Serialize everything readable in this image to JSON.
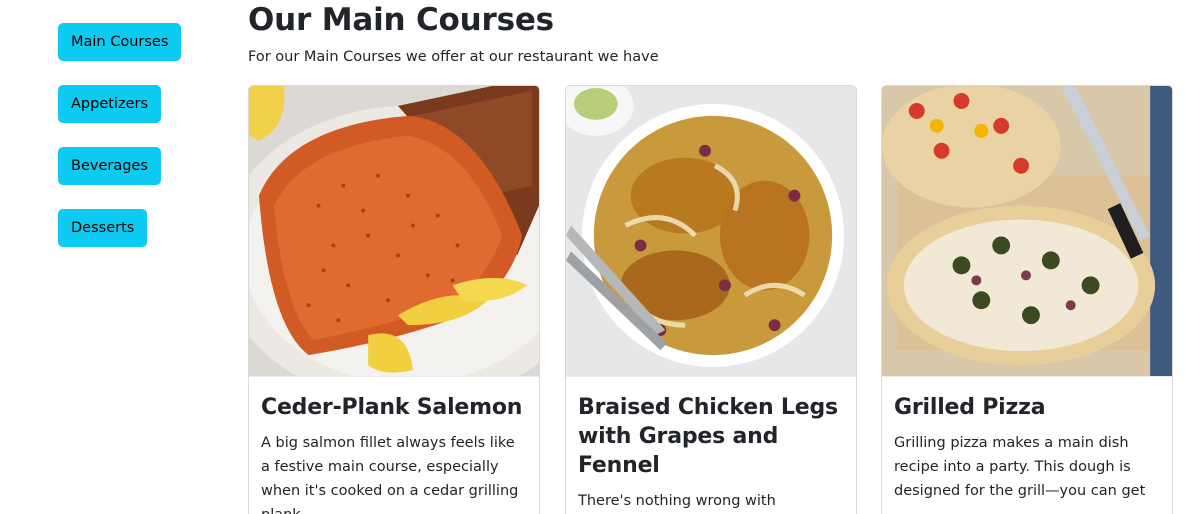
{
  "sidebar": {
    "items": [
      {
        "label": "Main Courses"
      },
      {
        "label": "Appetizers"
      },
      {
        "label": "Beverages"
      },
      {
        "label": "Desserts"
      }
    ]
  },
  "main": {
    "title": "Our Main Courses",
    "subtitle": "For our Main Courses we offer at our restaurant we have",
    "cards": [
      {
        "title": "Ceder-Plank Salemon",
        "text": "A big salmon fillet always feels like a festive main course, especially when it's cooked on a cedar grilling plank,",
        "image": "salmon-photo"
      },
      {
        "title": "Braised Chicken Legs with Grapes and Fennel",
        "text": "There's nothing wrong with defaulting to chicken when you're",
        "image": "chicken-photo"
      },
      {
        "title": "Grilled Pizza",
        "text": "Grilling pizza makes a main dish recipe into a party. This dough is designed for the grill—you can get",
        "image": "pizza-photo"
      }
    ]
  },
  "colors": {
    "button_bg": "#0dcaf0",
    "text": "#212529"
  }
}
